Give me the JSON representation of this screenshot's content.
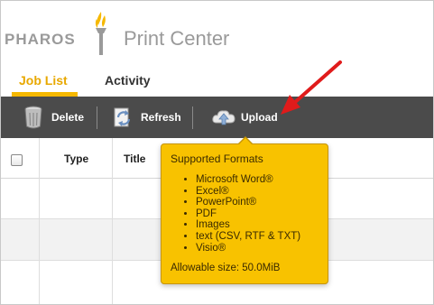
{
  "header": {
    "logo_text": "PHAROS",
    "app_title": "Print Center"
  },
  "tabs": [
    {
      "label": "Job List",
      "active": true
    },
    {
      "label": "Activity",
      "active": false
    }
  ],
  "toolbar": {
    "delete_label": "Delete",
    "refresh_label": "Refresh",
    "upload_label": "Upload"
  },
  "table": {
    "columns": [
      "Type",
      "Title"
    ]
  },
  "tooltip": {
    "title": "Supported Formats",
    "formats": [
      "Microsoft Word®",
      "Excel®",
      "PowerPoint®",
      "PDF",
      "Images",
      "text (CSV, RTF & TXT)",
      "Visio®"
    ],
    "allowable_size": "Allowable size: 50.0MiB"
  },
  "colors": {
    "accent": "#f6b800",
    "toolbar_bg": "#4b4b4b",
    "tooltip_bg": "#f8c200",
    "annotation_arrow": "#e01b1b"
  }
}
